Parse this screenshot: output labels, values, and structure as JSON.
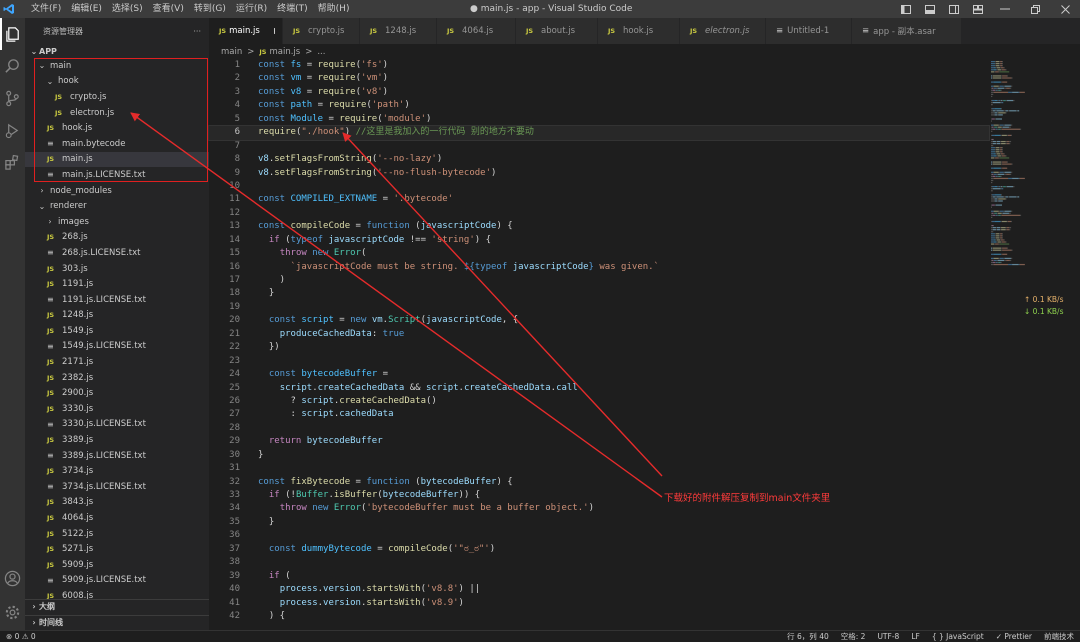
{
  "titlebar": {
    "menus": [
      "文件(F)",
      "编辑(E)",
      "选择(S)",
      "查看(V)",
      "转到(G)",
      "运行(R)",
      "终端(T)",
      "帮助(H)"
    ],
    "title": "● main.js - app - Visual Studio Code"
  },
  "sidebar": {
    "header": "资源管理器",
    "more": "···",
    "root": "APP",
    "items": [
      {
        "label": "main",
        "type": "folder-open",
        "indent": 1
      },
      {
        "label": "hook",
        "type": "folder-open",
        "indent": 2
      },
      {
        "label": "crypto.js",
        "type": "js",
        "indent": 3
      },
      {
        "label": "electron.js",
        "type": "js",
        "indent": 3
      },
      {
        "label": "hook.js",
        "type": "js",
        "indent": 2
      },
      {
        "label": "main.bytecode",
        "type": "file",
        "indent": 2
      },
      {
        "label": "main.js",
        "type": "js",
        "indent": 2,
        "selected": true
      },
      {
        "label": "main.js.LICENSE.txt",
        "type": "file",
        "indent": 2
      },
      {
        "label": "node_modules",
        "type": "folder-closed",
        "indent": 1
      },
      {
        "label": "renderer",
        "type": "folder-open",
        "indent": 1
      },
      {
        "label": "images",
        "type": "folder-closed",
        "indent": 2
      },
      {
        "label": "268.js",
        "type": "js",
        "indent": 2
      },
      {
        "label": "268.js.LICENSE.txt",
        "type": "file",
        "indent": 2
      },
      {
        "label": "303.js",
        "type": "js",
        "indent": 2
      },
      {
        "label": "1191.js",
        "type": "js",
        "indent": 2
      },
      {
        "label": "1191.js.LICENSE.txt",
        "type": "file",
        "indent": 2
      },
      {
        "label": "1248.js",
        "type": "js",
        "indent": 2
      },
      {
        "label": "1549.js",
        "type": "js",
        "indent": 2
      },
      {
        "label": "1549.js.LICENSE.txt",
        "type": "file",
        "indent": 2
      },
      {
        "label": "2171.js",
        "type": "js",
        "indent": 2
      },
      {
        "label": "2382.js",
        "type": "js",
        "indent": 2
      },
      {
        "label": "2900.js",
        "type": "js",
        "indent": 2
      },
      {
        "label": "3330.js",
        "type": "js",
        "indent": 2
      },
      {
        "label": "3330.js.LICENSE.txt",
        "type": "file",
        "indent": 2
      },
      {
        "label": "3389.js",
        "type": "js",
        "indent": 2
      },
      {
        "label": "3389.js.LICENSE.txt",
        "type": "file",
        "indent": 2
      },
      {
        "label": "3734.js",
        "type": "js",
        "indent": 2
      },
      {
        "label": "3734.js.LICENSE.txt",
        "type": "file",
        "indent": 2
      },
      {
        "label": "3843.js",
        "type": "js",
        "indent": 2
      },
      {
        "label": "4064.js",
        "type": "js",
        "indent": 2
      },
      {
        "label": "5122.js",
        "type": "js",
        "indent": 2
      },
      {
        "label": "5271.js",
        "type": "js",
        "indent": 2
      },
      {
        "label": "5909.js",
        "type": "js",
        "indent": 2
      },
      {
        "label": "5909.js.LICENSE.txt",
        "type": "file",
        "indent": 2
      },
      {
        "label": "6008.js",
        "type": "js",
        "indent": 2
      }
    ],
    "outline": "大纲",
    "timeline": "时间线"
  },
  "tabs": [
    {
      "label": "main.js",
      "icon": "js",
      "active": true,
      "dirty": true
    },
    {
      "label": "crypto.js",
      "icon": "js"
    },
    {
      "label": "1248.js",
      "icon": "js"
    },
    {
      "label": "4064.js",
      "icon": "js"
    },
    {
      "label": "about.js",
      "icon": "js"
    },
    {
      "label": "hook.js",
      "icon": "js"
    },
    {
      "label": "electron.js",
      "icon": "js"
    },
    {
      "label": "Untitled-1",
      "icon": "lines"
    },
    {
      "label": "app - 副本.asar",
      "icon": "lines"
    }
  ],
  "breadcrumb": [
    "main",
    ">",
    "JS",
    "main.js",
    ">",
    "..."
  ],
  "code": [
    [
      {
        "k": "k",
        "t": "const "
      },
      {
        "k": "cl",
        "t": "fs"
      },
      {
        "k": "",
        "t": " = "
      },
      {
        "k": "f",
        "t": "require"
      },
      {
        "k": "",
        "t": "("
      },
      {
        "k": "s",
        "t": "'fs'"
      },
      {
        "k": "",
        "t": ")"
      }
    ],
    [
      {
        "k": "k",
        "t": "const "
      },
      {
        "k": "cl",
        "t": "vm"
      },
      {
        "k": "",
        "t": " = "
      },
      {
        "k": "f",
        "t": "require"
      },
      {
        "k": "",
        "t": "("
      },
      {
        "k": "s",
        "t": "'vm'"
      },
      {
        "k": "",
        "t": ")"
      }
    ],
    [
      {
        "k": "k",
        "t": "const "
      },
      {
        "k": "cl",
        "t": "v8"
      },
      {
        "k": "",
        "t": " = "
      },
      {
        "k": "f",
        "t": "require"
      },
      {
        "k": "",
        "t": "("
      },
      {
        "k": "s",
        "t": "'v8'"
      },
      {
        "k": "",
        "t": ")"
      }
    ],
    [
      {
        "k": "k",
        "t": "const "
      },
      {
        "k": "cl",
        "t": "path"
      },
      {
        "k": "",
        "t": " = "
      },
      {
        "k": "f",
        "t": "require"
      },
      {
        "k": "",
        "t": "("
      },
      {
        "k": "s",
        "t": "'path'"
      },
      {
        "k": "",
        "t": ")"
      }
    ],
    [
      {
        "k": "k",
        "t": "const "
      },
      {
        "k": "cl",
        "t": "Module"
      },
      {
        "k": "",
        "t": " = "
      },
      {
        "k": "f",
        "t": "require"
      },
      {
        "k": "",
        "t": "("
      },
      {
        "k": "s",
        "t": "'module'"
      },
      {
        "k": "",
        "t": ")"
      }
    ],
    [
      {
        "k": "f",
        "t": "require"
      },
      {
        "k": "",
        "t": "("
      },
      {
        "k": "s",
        "t": "\"./hook\""
      },
      {
        "k": "",
        "t": ") "
      },
      {
        "k": "c",
        "t": "//这里是我加入的一行代码 别的地方不要动"
      }
    ],
    [],
    [
      {
        "k": "v",
        "t": "v8"
      },
      {
        "k": "",
        "t": "."
      },
      {
        "k": "f",
        "t": "setFlagsFromString"
      },
      {
        "k": "",
        "t": "("
      },
      {
        "k": "s",
        "t": "'--no-lazy'"
      },
      {
        "k": "",
        "t": ")"
      }
    ],
    [
      {
        "k": "v",
        "t": "v8"
      },
      {
        "k": "",
        "t": "."
      },
      {
        "k": "f",
        "t": "setFlagsFromString"
      },
      {
        "k": "",
        "t": "("
      },
      {
        "k": "s",
        "t": "'--no-flush-bytecode'"
      },
      {
        "k": "",
        "t": ")"
      }
    ],
    [],
    [
      {
        "k": "k",
        "t": "const "
      },
      {
        "k": "cl",
        "t": "COMPILED_EXTNAME"
      },
      {
        "k": "",
        "t": " = "
      },
      {
        "k": "s",
        "t": "'.bytecode'"
      }
    ],
    [],
    [
      {
        "k": "k",
        "t": "const "
      },
      {
        "k": "f",
        "t": "compileCode"
      },
      {
        "k": "",
        "t": " = "
      },
      {
        "k": "k",
        "t": "function"
      },
      {
        "k": "",
        "t": " ("
      },
      {
        "k": "v",
        "t": "javascriptCode"
      },
      {
        "k": "",
        "t": ") {"
      }
    ],
    [
      {
        "k": "",
        "t": "  "
      },
      {
        "k": "kc",
        "t": "if"
      },
      {
        "k": "",
        "t": " ("
      },
      {
        "k": "k",
        "t": "typeof"
      },
      {
        "k": "",
        "t": " "
      },
      {
        "k": "v",
        "t": "javascriptCode"
      },
      {
        "k": "",
        "t": " !== "
      },
      {
        "k": "s",
        "t": "'string'"
      },
      {
        "k": "",
        "t": ") {"
      }
    ],
    [
      {
        "k": "",
        "t": "    "
      },
      {
        "k": "kc",
        "t": "throw"
      },
      {
        "k": "",
        "t": " "
      },
      {
        "k": "k",
        "t": "new"
      },
      {
        "k": "",
        "t": " "
      },
      {
        "k": "t",
        "t": "Error"
      },
      {
        "k": "",
        "t": "("
      }
    ],
    [
      {
        "k": "",
        "t": "      "
      },
      {
        "k": "s",
        "t": "`javascriptCode must be string. "
      },
      {
        "k": "k",
        "t": "${typeof "
      },
      {
        "k": "v",
        "t": "javascriptCode"
      },
      {
        "k": "k",
        "t": "}"
      },
      {
        "k": "s",
        "t": " was given.`"
      }
    ],
    [
      {
        "k": "",
        "t": "    )"
      }
    ],
    [
      {
        "k": "",
        "t": "  }"
      }
    ],
    [],
    [
      {
        "k": "",
        "t": "  "
      },
      {
        "k": "k",
        "t": "const "
      },
      {
        "k": "cl",
        "t": "script"
      },
      {
        "k": "",
        "t": " = "
      },
      {
        "k": "k",
        "t": "new"
      },
      {
        "k": "",
        "t": " "
      },
      {
        "k": "v",
        "t": "vm"
      },
      {
        "k": "",
        "t": "."
      },
      {
        "k": "t",
        "t": "Script"
      },
      {
        "k": "",
        "t": "("
      },
      {
        "k": "v",
        "t": "javascriptCode"
      },
      {
        "k": "",
        "t": ", {"
      }
    ],
    [
      {
        "k": "",
        "t": "    "
      },
      {
        "k": "v",
        "t": "produceCachedData"
      },
      {
        "k": "",
        "t": ": "
      },
      {
        "k": "k",
        "t": "true"
      }
    ],
    [
      {
        "k": "",
        "t": "  })"
      }
    ],
    [],
    [
      {
        "k": "",
        "t": "  "
      },
      {
        "k": "k",
        "t": "const "
      },
      {
        "k": "cl",
        "t": "bytecodeBuffer"
      },
      {
        "k": "",
        "t": " ="
      }
    ],
    [
      {
        "k": "",
        "t": "    "
      },
      {
        "k": "v",
        "t": "script"
      },
      {
        "k": "",
        "t": "."
      },
      {
        "k": "v",
        "t": "createCachedData"
      },
      {
        "k": "",
        "t": " && "
      },
      {
        "k": "v",
        "t": "script"
      },
      {
        "k": "",
        "t": "."
      },
      {
        "k": "v",
        "t": "createCachedData"
      },
      {
        "k": "",
        "t": "."
      },
      {
        "k": "v",
        "t": "call"
      }
    ],
    [
      {
        "k": "",
        "t": "      ? "
      },
      {
        "k": "v",
        "t": "script"
      },
      {
        "k": "",
        "t": "."
      },
      {
        "k": "f",
        "t": "createCachedData"
      },
      {
        "k": "",
        "t": "()"
      }
    ],
    [
      {
        "k": "",
        "t": "      : "
      },
      {
        "k": "v",
        "t": "script"
      },
      {
        "k": "",
        "t": "."
      },
      {
        "k": "v",
        "t": "cachedData"
      }
    ],
    [],
    [
      {
        "k": "",
        "t": "  "
      },
      {
        "k": "kc",
        "t": "return"
      },
      {
        "k": "",
        "t": " "
      },
      {
        "k": "v",
        "t": "bytecodeBuffer"
      }
    ],
    [
      {
        "k": "",
        "t": "}"
      }
    ],
    [],
    [
      {
        "k": "k",
        "t": "const "
      },
      {
        "k": "f",
        "t": "fixBytecode"
      },
      {
        "k": "",
        "t": " = "
      },
      {
        "k": "k",
        "t": "function"
      },
      {
        "k": "",
        "t": " ("
      },
      {
        "k": "v",
        "t": "bytecodeBuffer"
      },
      {
        "k": "",
        "t": ") {"
      }
    ],
    [
      {
        "k": "",
        "t": "  "
      },
      {
        "k": "kc",
        "t": "if"
      },
      {
        "k": "",
        "t": " (!"
      },
      {
        "k": "t",
        "t": "Buffer"
      },
      {
        "k": "",
        "t": "."
      },
      {
        "k": "f",
        "t": "isBuffer"
      },
      {
        "k": "",
        "t": "("
      },
      {
        "k": "v",
        "t": "bytecodeBuffer"
      },
      {
        "k": "",
        "t": ")) {"
      }
    ],
    [
      {
        "k": "",
        "t": "    "
      },
      {
        "k": "kc",
        "t": "throw"
      },
      {
        "k": "",
        "t": " "
      },
      {
        "k": "k",
        "t": "new"
      },
      {
        "k": "",
        "t": " "
      },
      {
        "k": "t",
        "t": "Error"
      },
      {
        "k": "",
        "t": "("
      },
      {
        "k": "s",
        "t": "'bytecodeBuffer must be a buffer object.'"
      },
      {
        "k": "",
        "t": ")"
      }
    ],
    [
      {
        "k": "",
        "t": "  }"
      }
    ],
    [],
    [
      {
        "k": "",
        "t": "  "
      },
      {
        "k": "k",
        "t": "const "
      },
      {
        "k": "cl",
        "t": "dummyBytecode"
      },
      {
        "k": "",
        "t": " = "
      },
      {
        "k": "f",
        "t": "compileCode"
      },
      {
        "k": "",
        "t": "("
      },
      {
        "k": "s",
        "t": "'\"ಠ_ಠ\"'"
      },
      {
        "k": "",
        "t": ")"
      }
    ],
    [],
    [
      {
        "k": "",
        "t": "  "
      },
      {
        "k": "kc",
        "t": "if"
      },
      {
        "k": "",
        "t": " ("
      }
    ],
    [
      {
        "k": "",
        "t": "    "
      },
      {
        "k": "v",
        "t": "process"
      },
      {
        "k": "",
        "t": "."
      },
      {
        "k": "v",
        "t": "version"
      },
      {
        "k": "",
        "t": "."
      },
      {
        "k": "f",
        "t": "startsWith"
      },
      {
        "k": "",
        "t": "("
      },
      {
        "k": "s",
        "t": "'v8.8'"
      },
      {
        "k": "",
        "t": ") ||"
      }
    ],
    [
      {
        "k": "",
        "t": "    "
      },
      {
        "k": "v",
        "t": "process"
      },
      {
        "k": "",
        "t": "."
      },
      {
        "k": "v",
        "t": "version"
      },
      {
        "k": "",
        "t": "."
      },
      {
        "k": "f",
        "t": "startsWith"
      },
      {
        "k": "",
        "t": "("
      },
      {
        "k": "s",
        "t": "'v8.9'"
      },
      {
        "k": "",
        "t": ")"
      }
    ],
    [
      {
        "k": "",
        "t": "  ) {"
      }
    ]
  ],
  "current_line": 6,
  "network": {
    "up": "↑ 0.1 KB/s",
    "down": "↓ 0.1 KB/s"
  },
  "annotation": {
    "text": "下载好的附件解压复制到main文件夹里"
  },
  "statusbar": {
    "problems": "⊗ 0 ⚠ 0",
    "position": "行 6，列 40",
    "spaces": "空格: 2",
    "encoding": "UTF-8",
    "eol": "LF",
    "language": "{ } JavaScript",
    "prettier": "✓ Prettier",
    "extra": "前端技术"
  },
  "colors": {
    "accent": "#007acc",
    "annotation": "#ff2b2b"
  }
}
